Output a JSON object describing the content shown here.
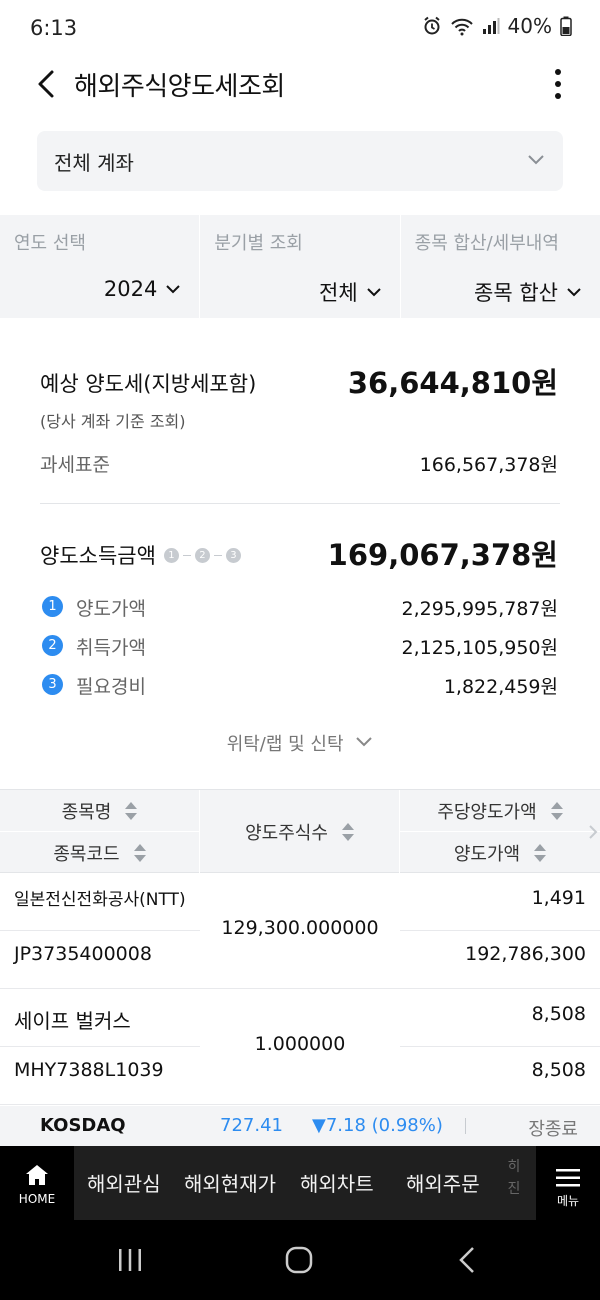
{
  "status": {
    "time": "6:13",
    "battery": "40%"
  },
  "header": {
    "title": "해외주식양도세조회"
  },
  "account": {
    "label": "전체 계좌"
  },
  "filters": [
    {
      "caption": "연도 선택",
      "value": "2024"
    },
    {
      "caption": "분기별 조회",
      "value": "전체"
    },
    {
      "caption": "종목 합산/세부내역",
      "value": "종목 합산"
    }
  ],
  "summary": {
    "tax_label": "예상 양도세(지방세포함)",
    "tax_value": "36,644,810원",
    "tax_note": "(당사 계좌 기준 조회)",
    "base_label": "과세표준",
    "base_value": "166,567,378원",
    "gain_label": "양도소득금액",
    "gain_value": "169,067,378원",
    "mini_steps": [
      "1",
      "2",
      "3"
    ],
    "items": [
      {
        "no": "1",
        "label": "양도가액",
        "amount": "2,295,995,787원"
      },
      {
        "no": "2",
        "label": "취득가액",
        "amount": "2,125,105,950원"
      },
      {
        "no": "3",
        "label": "필요경비",
        "amount": "1,822,459원"
      }
    ],
    "trust_link": "위탁/랩 및 신탁"
  },
  "table": {
    "headers": {
      "name": "종목명",
      "code": "종목코드",
      "qty": "양도주식수",
      "per_share": "주당양도가액",
      "sale_value": "양도가액"
    },
    "rows": [
      {
        "name": "일본전신전화공사(NTT)",
        "code": "JP3735400008",
        "qty": "129,300.000000",
        "per_share": "1,491",
        "sale_value": "192,786,300"
      },
      {
        "name": "세이프 벌커스",
        "code": "MHY7388L1039",
        "qty": "1.000000",
        "per_share": "8,508",
        "sale_value": "8,508"
      }
    ]
  },
  "ticker": {
    "index": "KOSDAQ",
    "price": "727.41",
    "change": "▼7.18 (0.98%)",
    "status": "장종료"
  },
  "nav": {
    "home": "HOME",
    "items": [
      "해외관심",
      "해외현재가",
      "해외차트",
      "해외주문"
    ],
    "partial": "히진",
    "menu": "메뉴"
  },
  "colors": {
    "accent": "#2d8cf0",
    "nav_bg": "#1f1f1f",
    "panel_bg": "#f3f4f6"
  }
}
